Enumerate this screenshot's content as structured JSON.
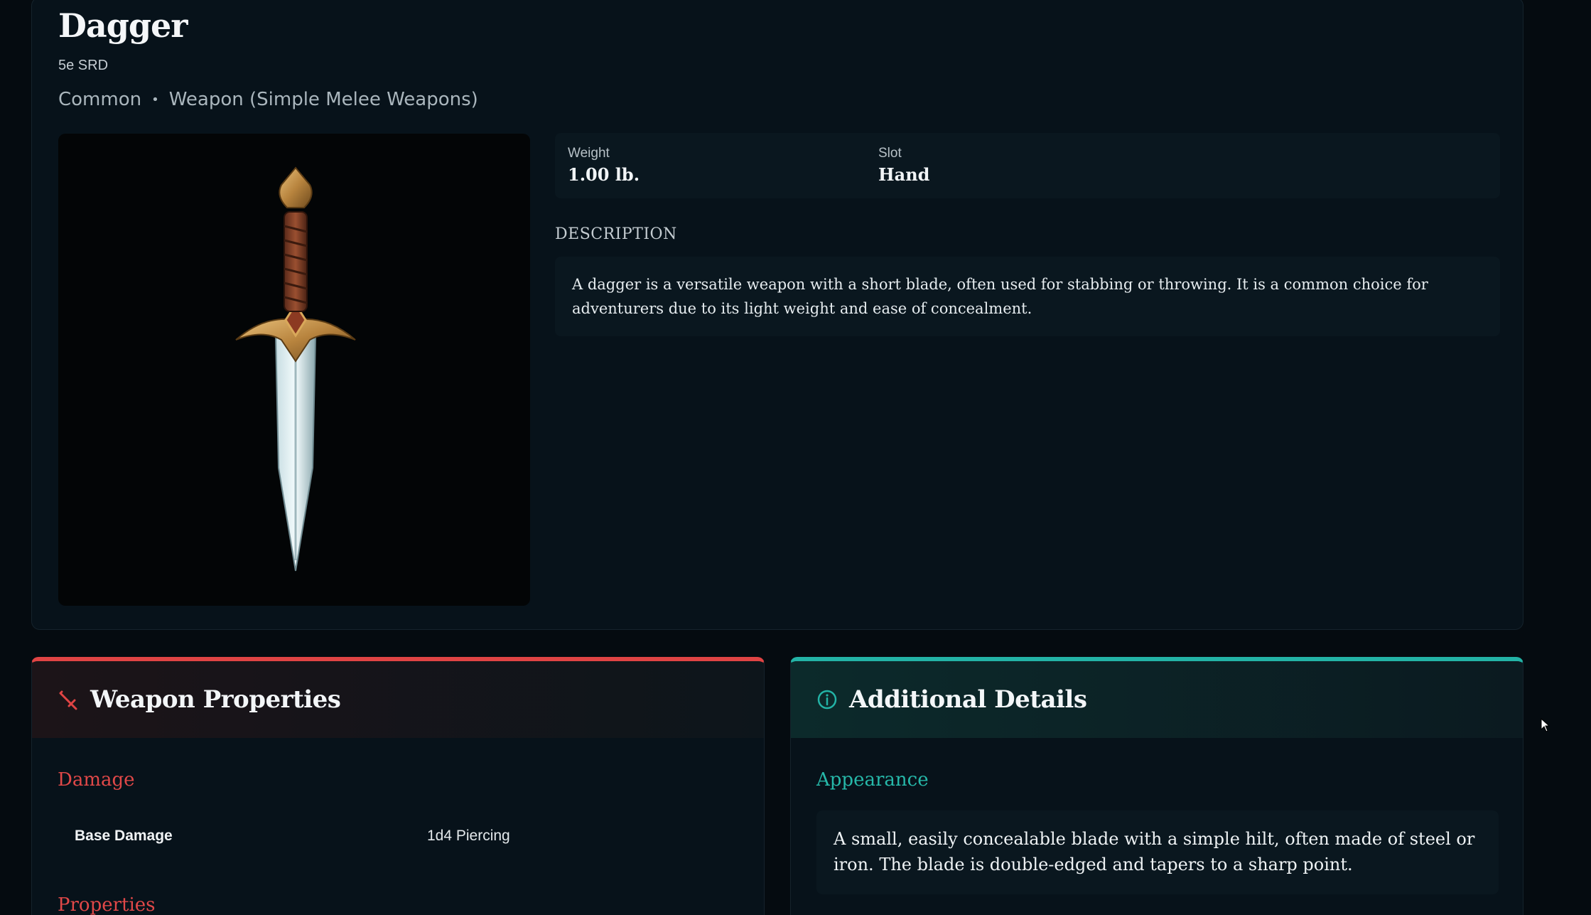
{
  "item": {
    "title": "Dagger",
    "source": "5e SRD",
    "rarity": "Common",
    "separator": "•",
    "type": "Weapon (Simple Melee Weapons)",
    "image_alt": "dagger-image"
  },
  "stats": {
    "weight_label": "Weight",
    "weight_value": "1.00 lb.",
    "slot_label": "Slot",
    "slot_value": "Hand"
  },
  "description": {
    "heading": "DESCRIPTION",
    "text": "A dagger is a versatile weapon with a short blade, often used for stabbing or throwing. It is a common choice for adventurers due to its light weight and ease of concealment."
  },
  "weapon_panel": {
    "title": "Weapon Properties",
    "icon": "sword-icon",
    "accent": "#e04444",
    "damage_heading": "Damage",
    "base_damage_label": "Base Damage",
    "base_damage_value": "1d4 Piercing",
    "properties_heading": "Properties"
  },
  "details_panel": {
    "title": "Additional Details",
    "icon": "info-icon",
    "accent": "#23b3a6",
    "appearance_heading": "Appearance",
    "appearance_text": "A small, easily concealable blade with a simple hilt, often made of steel or iron. The blade is double-edged and tapers to a sharp point."
  }
}
